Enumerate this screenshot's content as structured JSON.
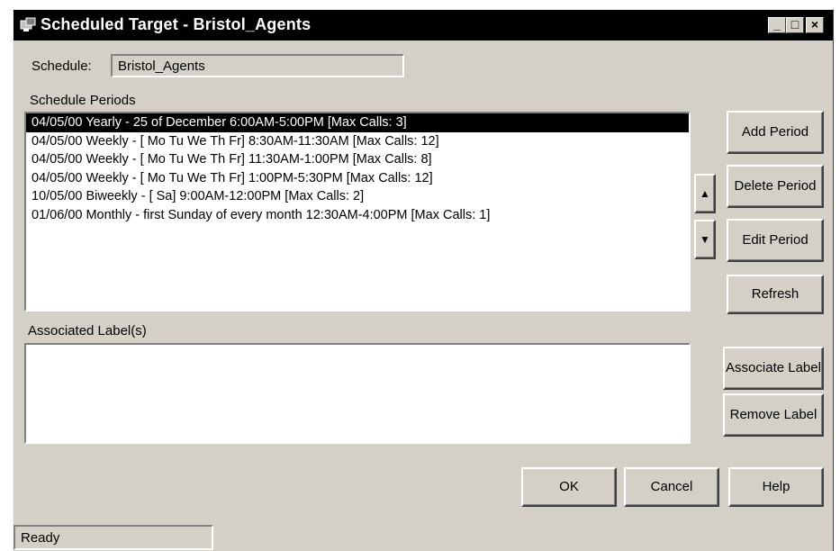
{
  "window": {
    "title": "Scheduled Target - Bristol_Agents",
    "minimize_glyph": "_",
    "maximize_glyph": "□",
    "close_glyph": "×"
  },
  "schedule": {
    "label": "Schedule:",
    "value": "Bristol_Agents"
  },
  "periods": {
    "label": "Schedule Periods",
    "items": [
      "04/05/00 Yearly - 25 of December 6:00AM-5:00PM   [Max Calls: 3]",
      "04/05/00 Weekly - [ Mo Tu We Th Fr]  8:30AM-11:30AM   [Max Calls: 12]",
      "04/05/00 Weekly - [ Mo Tu We Th Fr]  11:30AM-1:00PM   [Max Calls: 8]",
      "04/05/00 Weekly - [ Mo Tu We Th Fr]  1:00PM-5:30PM   [Max Calls: 12]",
      "10/05/00 Biweekly - [ Sa]  9:00AM-12:00PM   [Max Calls: 2]",
      "01/06/00 Monthly - first Sunday of every month 12:30AM-4:00PM   [Max Calls: 1]"
    ],
    "selected_index": 0
  },
  "buttons": {
    "add_period": "Add Period",
    "delete_period": "Delete Period",
    "edit_period": "Edit Period",
    "refresh": "Refresh",
    "move_up_glyph": "▲",
    "move_down_glyph": "▼",
    "associate_label": "Associate Label",
    "remove_label": "Remove Label",
    "ok": "OK",
    "cancel": "Cancel",
    "help": "Help"
  },
  "labels": {
    "label": "Associated Label(s)",
    "items": []
  },
  "status": {
    "text": "Ready"
  }
}
